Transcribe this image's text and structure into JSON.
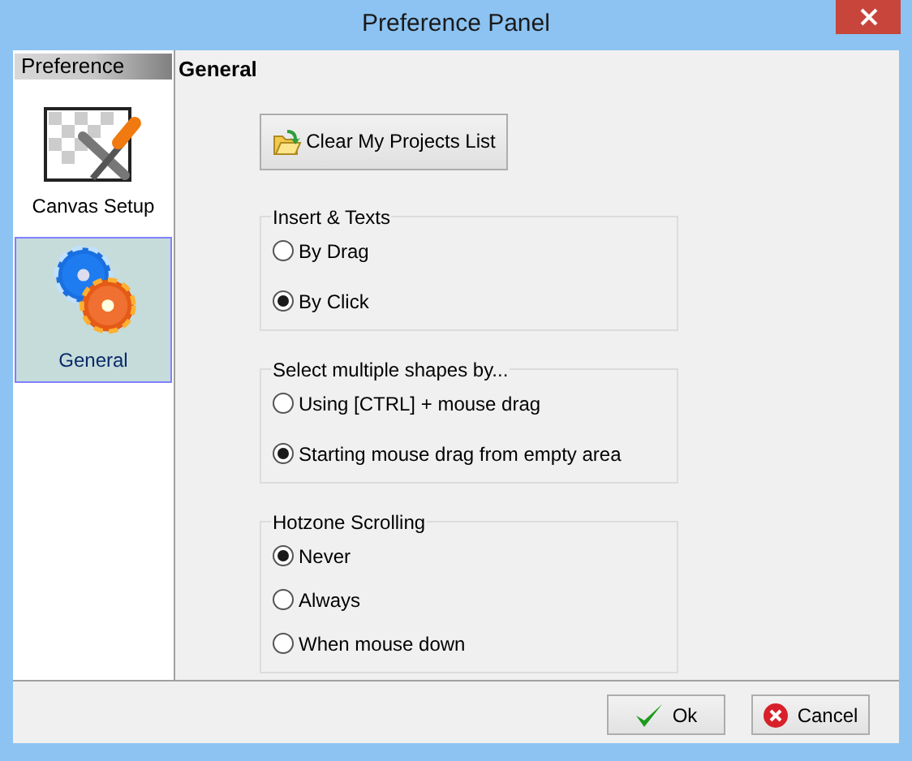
{
  "window": {
    "title": "Preference Panel"
  },
  "sidebar": {
    "header": "Preference",
    "items": [
      {
        "label": "Canvas Setup",
        "kind": "canvas",
        "selected": false
      },
      {
        "label": "General",
        "kind": "gears",
        "selected": true
      }
    ]
  },
  "page_title": "General",
  "clear_button": "Clear My Projects List",
  "groups": [
    {
      "legend": "Insert  & Texts",
      "options": [
        {
          "label": "By Drag",
          "selected": false
        },
        {
          "label": "By Click",
          "selected": true
        }
      ]
    },
    {
      "legend": "Select multiple shapes by...",
      "options": [
        {
          "label": "Using [CTRL] + mouse drag",
          "selected": false
        },
        {
          "label": "Starting mouse drag from empty area",
          "selected": true
        }
      ]
    },
    {
      "legend": "Hotzone Scrolling",
      "options": [
        {
          "label": "Never",
          "selected": true
        },
        {
          "label": "Always",
          "selected": false
        },
        {
          "label": "When mouse down",
          "selected": false
        }
      ]
    }
  ],
  "buttons": [
    {
      "label": "Ok",
      "kind": "ok"
    },
    {
      "label": "Cancel",
      "kind": "cancel"
    }
  ]
}
